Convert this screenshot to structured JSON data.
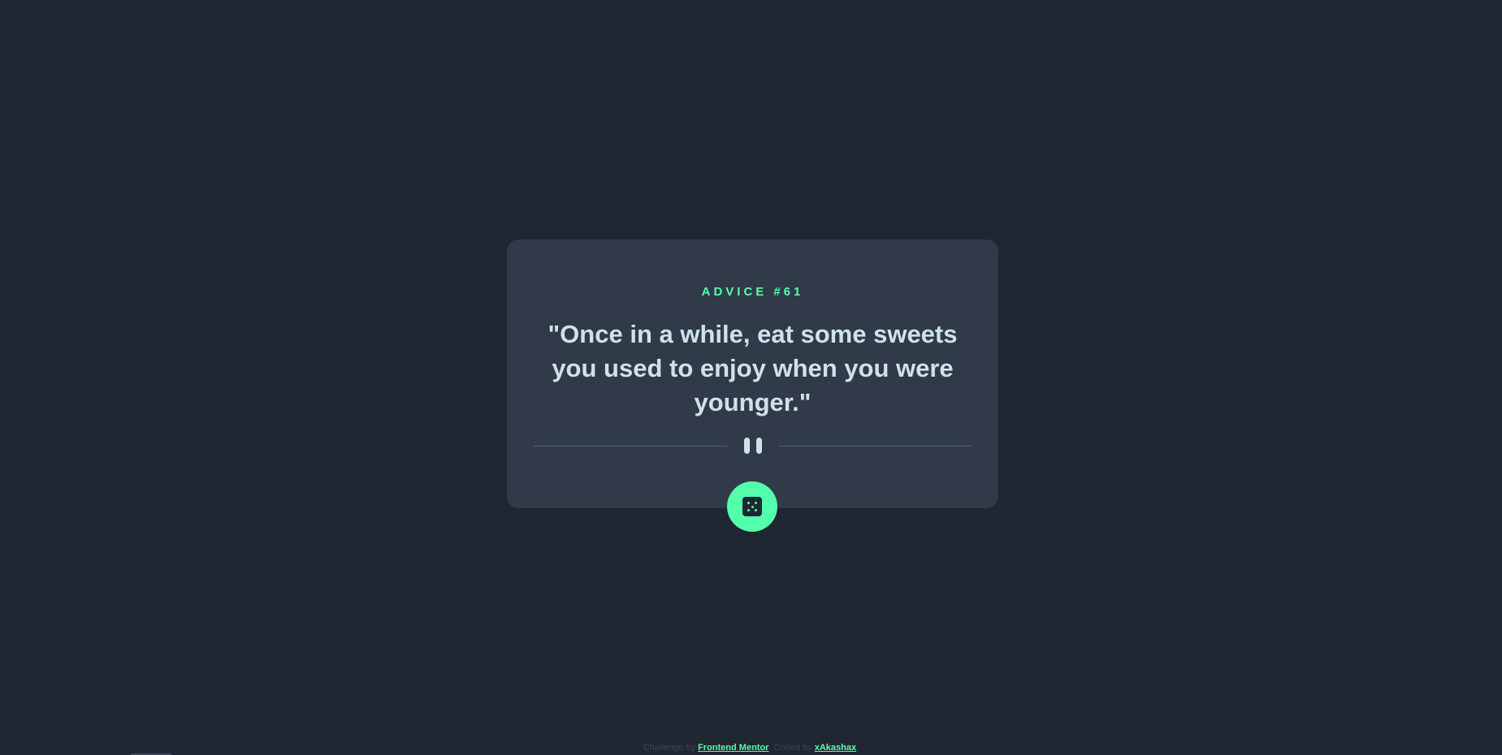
{
  "card": {
    "advice_label": "ADVICE",
    "advice_number": "#61",
    "quote": "\"Once in a while, eat some sweets you used to enjoy when you were younger.\""
  },
  "icons": {
    "divider": "pause-icon",
    "button": "dice-icon"
  },
  "footer": {
    "challenge_prefix": "Challenge by",
    "challenge_link": "Frontend Mentor",
    "coded_prefix": "Coded by",
    "coded_link": "xAkashax"
  },
  "colors": {
    "background": "#202632",
    "card": "#313a48",
    "accent": "#53ffab",
    "text": "#cee3e9",
    "divider": "#4f5d74"
  }
}
